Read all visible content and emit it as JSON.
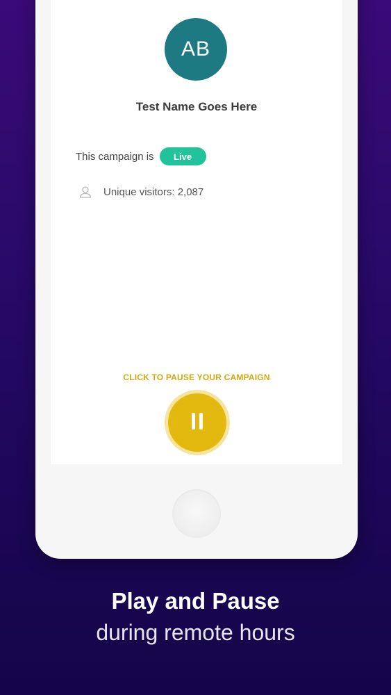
{
  "profile": {
    "initials": "AB",
    "name": "Test Name Goes Here",
    "avatar_color": "#1e7a82"
  },
  "campaign": {
    "status_label": "This campaign is",
    "status_badge": "Live",
    "badge_color": "#22c39a",
    "visitors_icon": "user-outline-icon",
    "visitors_text": "Unique visitors: 2,087"
  },
  "pause": {
    "hint": "CLICK TO PAUSE YOUR CAMPAIGN",
    "icon": "pause-icon",
    "color": "#e3b90f"
  },
  "caption": {
    "headline": "Play and Pause",
    "subheadline": "during remote hours"
  }
}
